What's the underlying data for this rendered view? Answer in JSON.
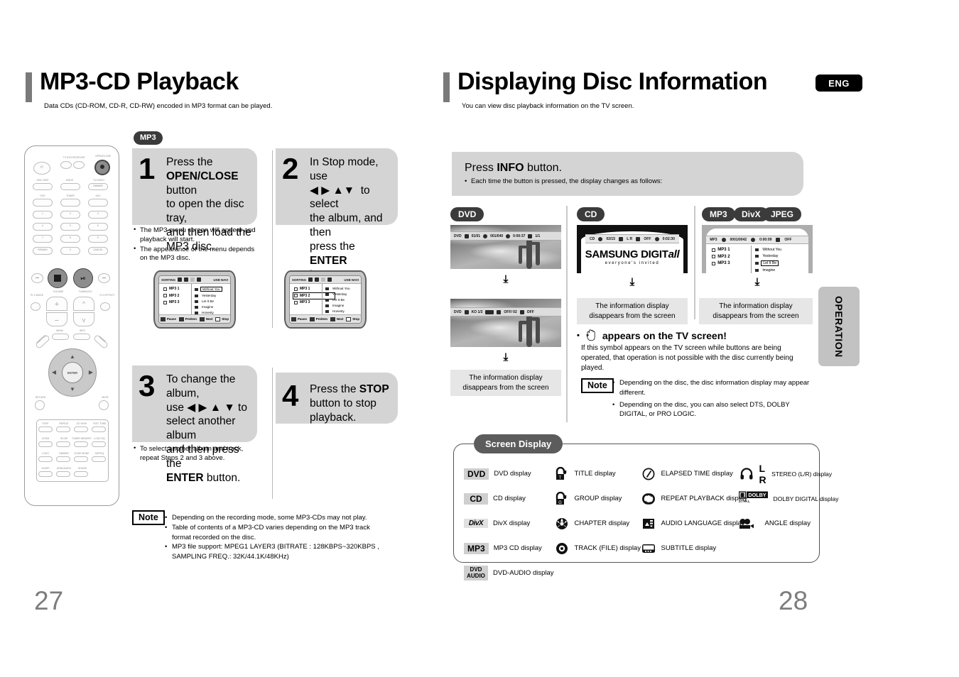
{
  "left_page": {
    "number": "27",
    "title": "MP3-CD Playback",
    "subtitle": "Data CDs (CD-ROM, CD-R, CD-RW) encoded in MP3 format can be played.",
    "disc_pill": "MP3",
    "steps": [
      {
        "num": "1",
        "text_parts": [
          "Press the ",
          "OPEN/CLOSE",
          " button to open the disc tray, and then load the MP3 disc."
        ],
        "bullets": [
          "The MP3 menu screen will appear and playback will start.",
          "The appearance of the menu depends on the MP3 disc."
        ]
      },
      {
        "num": "2",
        "text_parts": [
          "In Stop mode, use ◀ ▶ ▲ ▼  to select the album, and then press the ",
          "ENTER",
          " button."
        ],
        "bullets": []
      },
      {
        "num": "3",
        "text_parts": [
          "To change the album, use ◀ ▶ ▲ ▼ to select another album and then press the ",
          "ENTER",
          " button."
        ],
        "bullets": [
          "To select another album and track, repeat Steps 2 and 3 above."
        ]
      },
      {
        "num": "4",
        "text_parts": [
          "Press the ",
          "STOP",
          " button to stop playback."
        ],
        "bullets": []
      }
    ],
    "mp3_menu_screen": {
      "osd_label": "SORTING",
      "osd_right": "USB NAVI",
      "folders": [
        "MP3 1",
        "MP3 2",
        "MP3 3"
      ],
      "tracks": [
        "Without You",
        "Yesterday",
        "Let It Be",
        "Imagine",
        "Honesty"
      ],
      "selected_track": "Without You",
      "selected_folder_screen2": "MP3 2",
      "keys": [
        "Pause",
        "Preitem",
        "Next",
        "Stop"
      ]
    },
    "note": {
      "badge": "Note",
      "items": [
        "Depending on the recording mode, some MP3-CDs may not play.",
        "Table of contents of a MP3-CD varies depending on the MP3 track format recorded on the disc.",
        "MP3 file support: MPEG1 LAYER3 (BITRATE : 128KBPS~320KBPS , SAMPLING FREQ.: 32K/44.1K/48KHz)"
      ]
    },
    "remote_labels": {
      "open_close": "OPEN/CLOSE",
      "tv_dvd_receiver": "TV  DVD RECEIVER",
      "disc_skip": "DISC SKIP",
      "mode": "MODE",
      "tv_video": "TV/VIDEO",
      "tv_video_sub": "DIMMER",
      "dvd": "DVD",
      "tuner": "TUNER",
      "aux": "AUX",
      "keys": [
        "1",
        "2",
        "3",
        "4",
        "5",
        "6",
        "7",
        "8",
        "9"
      ],
      "remain": "REMAIN",
      "zero": "0",
      "cancel": "CANCEL",
      "volume": "VOLUME",
      "tuning": "TUNING/CH",
      "pl2_mode": "PL II MODE",
      "pl2_effect": "PL II EFFECT",
      "menu": "MENU",
      "info": "INFO",
      "subtitle": "SUBTITLE",
      "audio": "AUDIO",
      "enter": "ENTER",
      "return": "RETURN",
      "mute": "MUTE",
      "fn_rows": [
        [
          "STEP",
          "REPEAT",
          "EZ VIEW",
          "TEST TONE"
        ],
        [
          "ZOOM",
          "SLOW",
          "TUNER MEMORY",
          "LOUD EQ"
        ],
        [
          "LOGO",
          "DIMMER",
          "SLIDE MODE",
          "DSP/EQ"
        ],
        [
          "SLEEP",
          "HDMI AUDIO",
          "SOUND",
          ""
        ]
      ]
    }
  },
  "right_page": {
    "number": "28",
    "title": "Displaying Disc Information",
    "subtitle": "You can view disc playback information  on the TV screen.",
    "lang_badge": "ENG",
    "side_tab": "OPERATION",
    "info_box": {
      "heading_parts": [
        "Press ",
        "INFO",
        " button."
      ],
      "bullet": "Each time the button is pressed, the display changes as follows:"
    },
    "columns": [
      {
        "pills": [
          "DVD"
        ],
        "screens": [
          {
            "osd": [
              "DVD",
              "01/01",
              "001/040",
              "0:00:37",
              "1/1"
            ]
          },
          {
            "osd": [
              "DVD",
              "KO 1/3",
              "ANGLE",
              "OFF/ 02",
              "OFF"
            ]
          }
        ],
        "caption": "The information display disappears from the screen"
      },
      {
        "pills": [
          "CD"
        ],
        "screens": [
          {
            "osd": [
              "CD",
              "02/15",
              "L R",
              "OFF",
              "0:02:30"
            ]
          }
        ],
        "logo_line1": "SAMSUNG DIGIT",
        "logo_line1_italic": "all",
        "logo_line2": "everyone's invited",
        "caption": "The information display disappears from the screen"
      },
      {
        "pills": [
          "MP3",
          "DivX",
          "JPEG"
        ],
        "screens": [
          {
            "osd": [
              "MP3",
              "0001/0042",
              "0:00:09",
              "OFF"
            ]
          }
        ],
        "folders": [
          "MP3 1",
          "MP3 2",
          "MP3 3"
        ],
        "tracks": [
          "Without You",
          "Yesterday",
          "Let It Be",
          "Imagine"
        ],
        "selected_track": "Let It Be",
        "caption": "The information display disappears from the screen"
      }
    ],
    "hand_warning": {
      "text": "appears on the TV screen!",
      "detail": "If this symbol appears on the TV screen while buttons are being operated, that operation is not possible with the disc currently being played."
    },
    "note": {
      "badge": "Note",
      "items": [
        "Depending on the disc, the disc information display may appear different.",
        "Depending on the disc, you can also select DTS, DOLBY DIGITAL, or PRO LOGIC."
      ]
    },
    "screen_display": {
      "tab": "Screen Display",
      "col1": [
        {
          "tag": "DVD",
          "tag_style": "box",
          "label": "DVD display"
        },
        {
          "tag": "CD",
          "tag_style": "box",
          "label": "CD display"
        },
        {
          "tag": "DivX",
          "tag_style": "divx",
          "label": "DivX display"
        },
        {
          "tag": "MP3",
          "tag_style": "box",
          "label": "MP3 CD display"
        },
        {
          "tag": "DVD AUDIO",
          "tag_style": "box2",
          "label": "DVD-AUDIO display"
        }
      ],
      "col2": [
        {
          "icon": "title-icon",
          "label": "TITLE display"
        },
        {
          "icon": "group-icon",
          "label": "GROUP display"
        },
        {
          "icon": "chapter-icon",
          "label": "CHAPTER display"
        },
        {
          "icon": "track-file-icon",
          "label": "TRACK (FILE) display"
        }
      ],
      "col3": [
        {
          "icon": "clock-icon",
          "label": "ELAPSED TIME display"
        },
        {
          "icon": "repeat-icon",
          "label": "REPEAT PLAYBACK display"
        },
        {
          "icon": "audio-language-icon",
          "label": "AUDIO LANGUAGE display"
        },
        {
          "icon": "subtitle-icon",
          "label": "SUBTITLE display"
        }
      ],
      "col4": [
        {
          "icon": "headphones-icon",
          "extra": "L R",
          "label": "STEREO (L/R) display"
        },
        {
          "icon": "dolby-icon",
          "extra": "DOLBY DIGITAL",
          "label": "DOLBY DIGITAL display"
        },
        {
          "icon": "angle-camera-icon",
          "label": "ANGLE display"
        }
      ]
    }
  },
  "colors": {
    "grey_box": "#d4d4d4",
    "dark_pill": "#3b3b3b",
    "tab_grey": "#c2c2c2",
    "page_num": "#7d7d7d",
    "caption_bg": "#e6e6e6"
  }
}
